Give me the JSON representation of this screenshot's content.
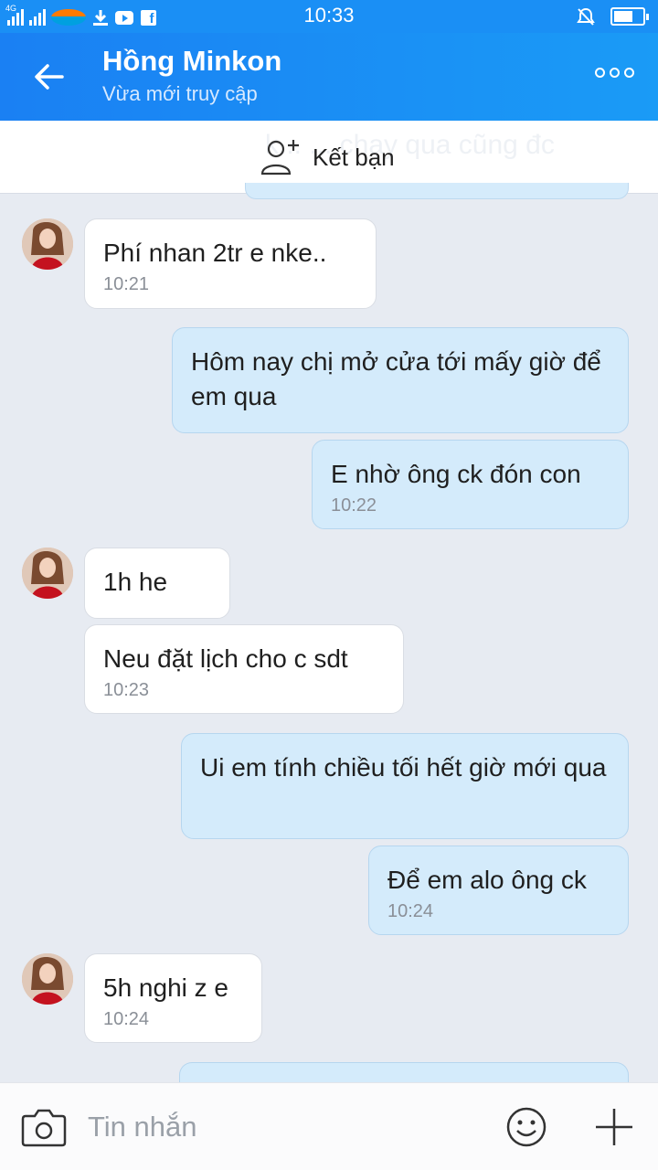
{
  "status_bar": {
    "time": "10:33",
    "network_tag": "4G",
    "battery_level": 0.7,
    "icons": [
      "signal-icon",
      "carrier-logo",
      "download-icon",
      "youtube-icon",
      "facebook-icon",
      "mute-icon",
      "battery-icon"
    ]
  },
  "header": {
    "name": "Hồng Minkon",
    "status": "Vừa mới truy cập",
    "back_icon": "arrow-left-icon",
    "more_icon": "more-dots-icon"
  },
  "add_friend": {
    "label": "Kết bạn",
    "ghost_text": "k... ... chạy qua cũng đc"
  },
  "messages": [
    {
      "from": "them",
      "text": "Phí nhan 2tr e nke..",
      "time": "10:21"
    },
    {
      "from": "me",
      "text": "Hôm nay chị mở cửa tới mấy giờ để em qua",
      "time": ""
    },
    {
      "from": "me",
      "text": "E nhờ ông ck đón con",
      "time": "10:22"
    },
    {
      "from": "them",
      "text": "1h he",
      "time": ""
    },
    {
      "from": "them",
      "text": "Neu đặt lịch cho c sdt",
      "time": "10:23"
    },
    {
      "from": "me",
      "text": "Ui em tính chiều tối hết giờ mới qua",
      "time": ""
    },
    {
      "from": "me",
      "text": "Để em alo ông ck",
      "time": "10:24"
    },
    {
      "from": "them",
      "text": "5h nghi z e",
      "time": "10:24"
    }
  ],
  "input": {
    "placeholder": "Tin nhắn",
    "camera_icon": "camera-icon",
    "emoji_icon": "emoji-icon",
    "plus_icon": "plus-icon"
  },
  "colors": {
    "header": "#1a8ff5",
    "incoming_bubble": "#ffffff",
    "outgoing_bubble": "#d4ebfb",
    "background": "#e7ebf2"
  }
}
